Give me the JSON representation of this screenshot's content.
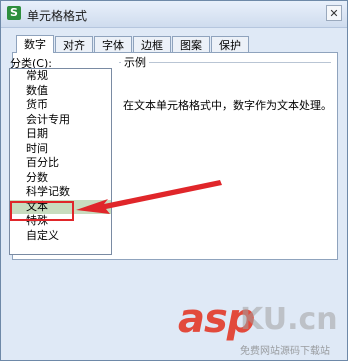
{
  "dialog": {
    "title": "单元格格式",
    "app_icon": "S",
    "close_glyph": "✕"
  },
  "tabs": [
    {
      "label": "数字",
      "active": true
    },
    {
      "label": "对齐"
    },
    {
      "label": "字体"
    },
    {
      "label": "边框"
    },
    {
      "label": "图案"
    },
    {
      "label": "保护"
    }
  ],
  "category": {
    "label": "分类(C):",
    "items": [
      "常规",
      "数值",
      "货币",
      "会计专用",
      "日期",
      "时间",
      "百分比",
      "分数",
      "科学记数",
      "文本",
      "特殊",
      "自定义"
    ],
    "selected": "文本"
  },
  "preview": {
    "legend": "示例",
    "value": ""
  },
  "description": "在文本单元格格式中，数字作为文本处理。",
  "annotation": {
    "highlight_color": "#e0262a",
    "arrow_color": "#e0262a"
  },
  "watermark": {
    "brand": "asp",
    "site": "KU.cn",
    "tagline": "免费网站源码下载站"
  }
}
